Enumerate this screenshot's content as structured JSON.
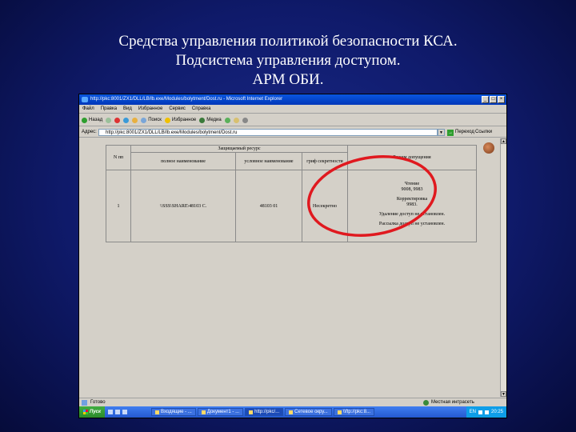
{
  "slide": {
    "title_lines": [
      "Средства управления политикой безопасности КСА.",
      "Подсистема управления доступом.",
      "АРМ ОБИ."
    ]
  },
  "browser": {
    "title": "http://pkc:8001/ZX1/DLL/LB/lb.exe/Modules/bolytment/Dost.ru - Microsoft Internet Explorer",
    "menu": [
      "Файл",
      "Правка",
      "Вид",
      "Избранное",
      "Сервис",
      "Справка"
    ],
    "toolbar": {
      "back": "Назад",
      "search": "Поиск",
      "favorites": "Избранное",
      "media": "Медиа"
    },
    "address": {
      "label": "Адрес:",
      "value": "http://pkc:8001/ZX1/DLL/LB/lb.exe/Modules/bolytment/Dost.ru",
      "go": "Переход",
      "links": "Ссылки"
    },
    "table": {
      "protected_resource": "Защищаемый ресурс",
      "col_num": "N пп",
      "col_full": "полное наименование",
      "col_cond": "условное наименование",
      "col_grif": "гриф секретности",
      "col_mode": "Режим допущения",
      "rows": [
        {
          "num": "1",
          "full": "\\\\SSS\\SHARE\\48103 С.",
          "cond": "48103 01",
          "grif": "Несекретно",
          "mode_lines": [
            "Чтение\n9008, 9983",
            "Корректировка\n9983.",
            "Удаление доступ не установлен.",
            "Рассылка доступ не установлен."
          ]
        }
      ]
    },
    "status": {
      "left": "Готово",
      "zone": "Местная интрасеть"
    },
    "taskbar": {
      "start": "Пуск",
      "tasks": [
        "Входящие - ...",
        "Документ1 - ...",
        "http://pkc/...",
        "Сетевое окру...",
        "\\\\ftp://pkc:8..."
      ],
      "lang": "EN",
      "clock": "20:25"
    }
  },
  "colors": {
    "background": "#0f1a6a",
    "annotation_circle": "#e0191f",
    "title_bar": "#0a56e0"
  }
}
